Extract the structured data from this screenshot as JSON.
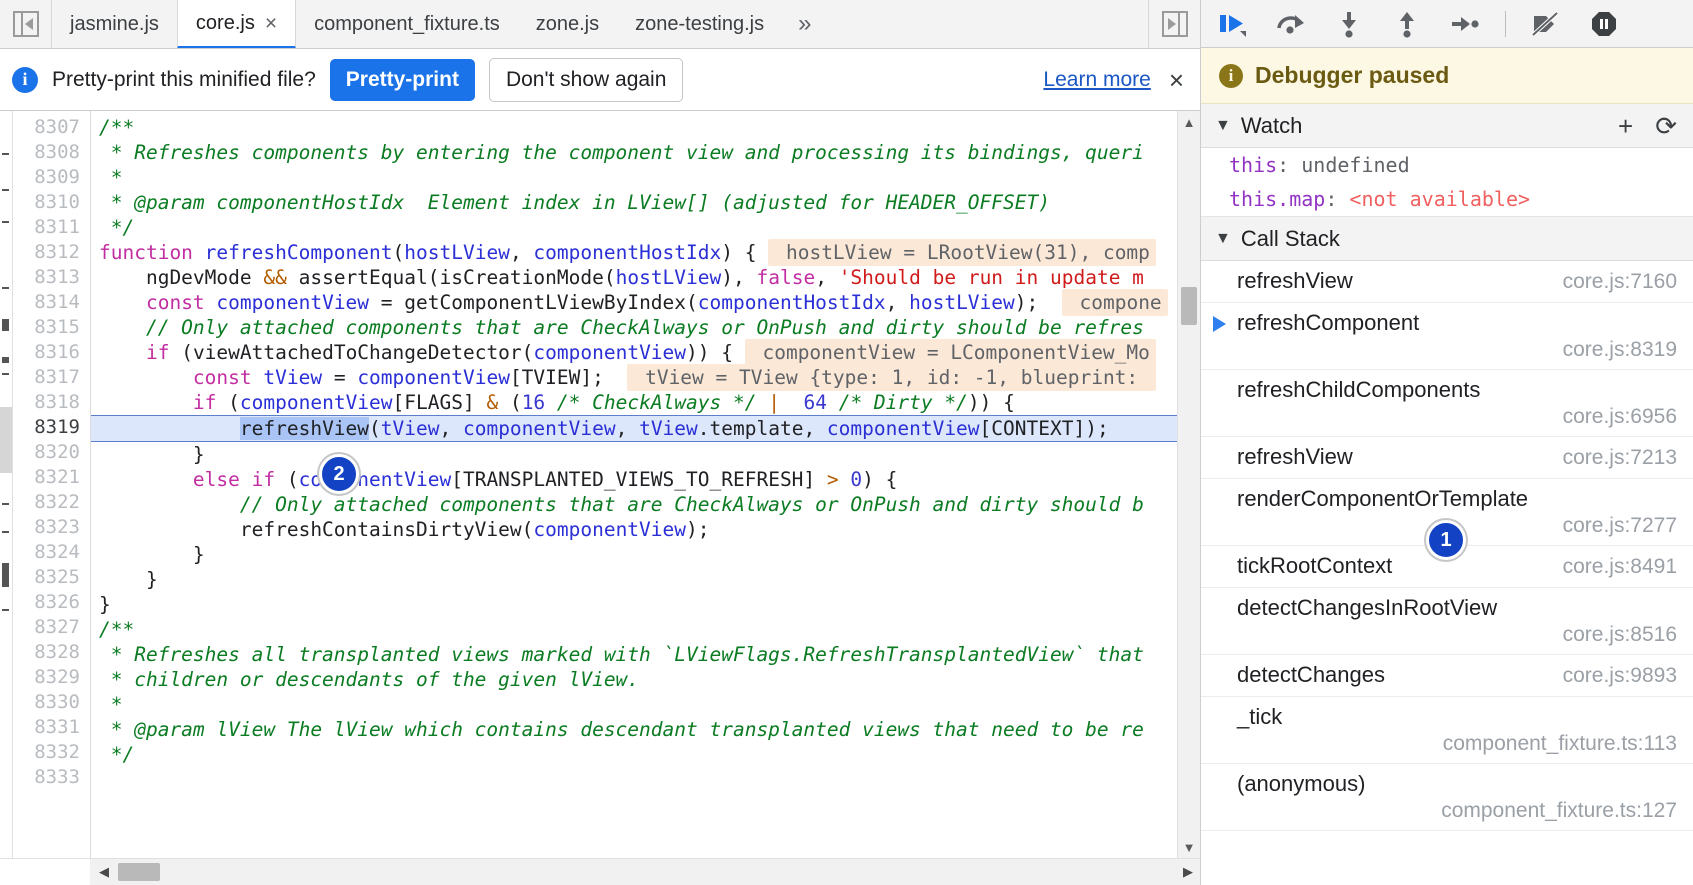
{
  "tabs": {
    "nav_prev_icon": "collapse-left-icon",
    "nav_next_icon": "expand-right-icon",
    "more_label": "»",
    "items": [
      {
        "label": "jasmine.js",
        "active": false,
        "closable": false
      },
      {
        "label": "core.js",
        "active": true,
        "closable": true,
        "close_label": "×"
      },
      {
        "label": "component_fixture.ts",
        "active": false,
        "closable": false
      },
      {
        "label": "zone.js",
        "active": false,
        "closable": false
      },
      {
        "label": "zone-testing.js",
        "active": false,
        "closable": false
      }
    ]
  },
  "infobar": {
    "icon": "info-icon",
    "message": "Pretty-print this minified file?",
    "primary_button": "Pretty-print",
    "secondary_button": "Don't show again",
    "learn_more": "Learn more",
    "close_label": "×",
    "accent_color": "#1a73e8"
  },
  "editor": {
    "first_line": 8307,
    "highlighted_line": 8319,
    "selected_token": "refreshView",
    "breakpoint_badge": "2",
    "scroll_arrow_up": "▲",
    "scroll_arrow_down": "▼",
    "hscroll_left": "◀",
    "hscroll_right": "▶",
    "line_numbers": [
      "8307",
      "8308",
      "8309",
      "8310",
      "8311",
      "8312",
      "8313",
      "8314",
      "8315",
      "8316",
      "8317",
      "8318",
      "8319",
      "8320",
      "8321",
      "8322",
      "8323",
      "8324",
      "8325",
      "8326",
      "8327",
      "8328",
      "8329",
      "8330",
      "8331",
      "8332",
      "8333"
    ],
    "lines": [
      {
        "n": "8307",
        "segs": [
          {
            "t": "/**",
            "c": "cmt"
          }
        ]
      },
      {
        "n": "8308",
        "segs": [
          {
            "t": " * Refreshes components by entering the component view and processing its bindings, queri",
            "c": "cmt"
          }
        ]
      },
      {
        "n": "8309",
        "segs": [
          {
            "t": " *",
            "c": "cmt"
          }
        ]
      },
      {
        "n": "8310",
        "segs": [
          {
            "t": " * @param componentHostIdx  Element index in LView[] (adjusted for HEADER_OFFSET)",
            "c": "cmt"
          }
        ]
      },
      {
        "n": "8311",
        "segs": [
          {
            "t": " */",
            "c": "cmt"
          }
        ]
      },
      {
        "n": "8312",
        "segs": [
          {
            "t": "function ",
            "c": "kw"
          },
          {
            "t": "refreshComponent",
            "c": "fn"
          },
          {
            "t": "(",
            "c": "id"
          },
          {
            "t": "hostLView",
            "c": "fn"
          },
          {
            "t": ", ",
            "c": "id"
          },
          {
            "t": "componentHostIdx",
            "c": "fn"
          },
          {
            "t": ") { ",
            "c": "id"
          },
          {
            "t": " hostLView = LRootView(31), comp",
            "c": "eval"
          }
        ]
      },
      {
        "n": "8313",
        "segs": [
          {
            "t": "    ngDevMode ",
            "c": "id"
          },
          {
            "t": "&&",
            "c": "op"
          },
          {
            "t": " assertEqual(isCreationMode(",
            "c": "id"
          },
          {
            "t": "hostLView",
            "c": "fn"
          },
          {
            "t": "), ",
            "c": "id"
          },
          {
            "t": "false",
            "c": "kw"
          },
          {
            "t": ", ",
            "c": "id"
          },
          {
            "t": "'Should be run in update m",
            "c": "str"
          }
        ]
      },
      {
        "n": "8314",
        "segs": [
          {
            "t": "    ",
            "c": "id"
          },
          {
            "t": "const ",
            "c": "kw"
          },
          {
            "t": "componentView",
            "c": "fn"
          },
          {
            "t": " = getComponentLViewByIndex(",
            "c": "id"
          },
          {
            "t": "componentHostIdx",
            "c": "fn"
          },
          {
            "t": ", ",
            "c": "id"
          },
          {
            "t": "hostLView",
            "c": "fn"
          },
          {
            "t": ");  ",
            "c": "id"
          },
          {
            "t": " compone",
            "c": "eval"
          }
        ]
      },
      {
        "n": "8315",
        "segs": [
          {
            "t": "    // Only attached components that are CheckAlways or OnPush and dirty should be refres",
            "c": "cmt"
          }
        ]
      },
      {
        "n": "8316",
        "segs": [
          {
            "t": "    ",
            "c": "id"
          },
          {
            "t": "if ",
            "c": "kw"
          },
          {
            "t": "(viewAttachedToChangeDetector(",
            "c": "id"
          },
          {
            "t": "componentView",
            "c": "fn"
          },
          {
            "t": ")) { ",
            "c": "id"
          },
          {
            "t": " componentView = LComponentView_Mo",
            "c": "eval"
          }
        ]
      },
      {
        "n": "8317",
        "segs": [
          {
            "t": "        ",
            "c": "id"
          },
          {
            "t": "const ",
            "c": "kw"
          },
          {
            "t": "tView",
            "c": "fn"
          },
          {
            "t": " = ",
            "c": "id"
          },
          {
            "t": "componentView",
            "c": "fn"
          },
          {
            "t": "[TVIEW];  ",
            "c": "id"
          },
          {
            "t": " tView = TView {type: 1, id: -1, blueprint: ",
            "c": "eval"
          }
        ]
      },
      {
        "n": "8318",
        "segs": [
          {
            "t": "        ",
            "c": "id"
          },
          {
            "t": "if ",
            "c": "kw"
          },
          {
            "t": "(",
            "c": "id"
          },
          {
            "t": "componentView",
            "c": "fn"
          },
          {
            "t": "[FLAGS] ",
            "c": "id"
          },
          {
            "t": "& ",
            "c": "op"
          },
          {
            "t": "(",
            "c": "id"
          },
          {
            "t": "16",
            "c": "num"
          },
          {
            "t": " /* CheckAlways */",
            "c": "cmt"
          },
          {
            "t": " | ",
            "c": "op"
          },
          {
            "t": " ",
            "c": "id"
          },
          {
            "t": "64",
            "c": "num"
          },
          {
            "t": " /* Dirty */",
            "c": "cmt"
          },
          {
            "t": ")) {",
            "c": "id"
          }
        ]
      },
      {
        "n": "8319",
        "exec": true,
        "segs": [
          {
            "t": "            ",
            "c": "id"
          },
          {
            "t": "refreshView",
            "c": "sel-token"
          },
          {
            "t": "(",
            "c": "id"
          },
          {
            "t": "tView",
            "c": "fn"
          },
          {
            "t": ", ",
            "c": "id"
          },
          {
            "t": "componentView",
            "c": "fn"
          },
          {
            "t": ", ",
            "c": "id"
          },
          {
            "t": "tView",
            "c": "fn"
          },
          {
            "t": ".template, ",
            "c": "id"
          },
          {
            "t": "componentView",
            "c": "fn"
          },
          {
            "t": "[CONTEXT]);",
            "c": "id"
          }
        ]
      },
      {
        "n": "8320",
        "segs": [
          {
            "t": "        }",
            "c": "id"
          }
        ]
      },
      {
        "n": "8321",
        "segs": [
          {
            "t": "        ",
            "c": "id"
          },
          {
            "t": "else if ",
            "c": "kw"
          },
          {
            "t": "(",
            "c": "id"
          },
          {
            "t": "componentView",
            "c": "fn"
          },
          {
            "t": "[TRANSPLANTED_VIEWS_TO_REFRESH] ",
            "c": "id"
          },
          {
            "t": "> ",
            "c": "op"
          },
          {
            "t": "0",
            "c": "num"
          },
          {
            "t": ") {",
            "c": "id"
          }
        ]
      },
      {
        "n": "8322",
        "segs": [
          {
            "t": "            // Only attached components that are CheckAlways or OnPush and dirty should b",
            "c": "cmt"
          }
        ]
      },
      {
        "n": "8323",
        "segs": [
          {
            "t": "            refreshContainsDirtyView(",
            "c": "id"
          },
          {
            "t": "componentView",
            "c": "fn"
          },
          {
            "t": ");",
            "c": "id"
          }
        ]
      },
      {
        "n": "8324",
        "segs": [
          {
            "t": "        }",
            "c": "id"
          }
        ]
      },
      {
        "n": "8325",
        "segs": [
          {
            "t": "    }",
            "c": "id"
          }
        ]
      },
      {
        "n": "8326",
        "segs": [
          {
            "t": "}",
            "c": "id"
          }
        ]
      },
      {
        "n": "8327",
        "segs": [
          {
            "t": "/**",
            "c": "cmt"
          }
        ]
      },
      {
        "n": "8328",
        "segs": [
          {
            "t": " * Refreshes all transplanted views marked with `LViewFlags.RefreshTransplantedView` that",
            "c": "cmt"
          }
        ]
      },
      {
        "n": "8329",
        "segs": [
          {
            "t": " * children or descendants of the given lView.",
            "c": "cmt"
          }
        ]
      },
      {
        "n": "8330",
        "segs": [
          {
            "t": " *",
            "c": "cmt"
          }
        ]
      },
      {
        "n": "8331",
        "segs": [
          {
            "t": " * @param lView The lView which contains descendant transplanted views that need to be re",
            "c": "cmt"
          }
        ]
      },
      {
        "n": "8332",
        "segs": [
          {
            "t": " */",
            "c": "cmt"
          }
        ]
      },
      {
        "n": "8333",
        "segs": [
          {
            "t": "",
            "c": "id"
          }
        ]
      }
    ]
  },
  "debugger": {
    "toolbar": [
      {
        "name": "resume-script-execution-button",
        "icon": "resume-icon"
      },
      {
        "name": "step-over-button",
        "icon": "step-over-icon"
      },
      {
        "name": "step-into-button",
        "icon": "step-into-icon"
      },
      {
        "name": "step-out-button",
        "icon": "step-out-icon"
      },
      {
        "name": "step-button",
        "icon": "step-icon"
      },
      {
        "name": "deactivate-breakpoints-button",
        "icon": "deactivate-breakpoints-icon"
      },
      {
        "name": "pause-on-exceptions-button",
        "icon": "pause-on-exceptions-icon"
      }
    ],
    "paused": {
      "icon": "info-circle-icon",
      "text": "Debugger paused"
    },
    "watch": {
      "caret": "▼",
      "title": "Watch",
      "add_label": "+",
      "refresh_label": "⟳",
      "entries": [
        {
          "name": "this",
          "separator": ": ",
          "value": "undefined",
          "value_kind": "undefined"
        },
        {
          "name": "this.map",
          "separator": ": ",
          "value": "<not available>",
          "value_kind": "not-available"
        }
      ]
    },
    "call_stack": {
      "caret": "▼",
      "title": "Call Stack",
      "badge": "1",
      "frames": [
        {
          "name": "refreshView",
          "location": "core.js:7160",
          "selected": false,
          "wrapped": false
        },
        {
          "name": "refreshComponent",
          "location": "core.js:8319",
          "selected": true,
          "wrapped": true
        },
        {
          "name": "refreshChildComponents",
          "location": "core.js:6956",
          "selected": false,
          "wrapped": true
        },
        {
          "name": "refreshView",
          "location": "core.js:7213",
          "selected": false,
          "wrapped": false
        },
        {
          "name": "renderComponentOrTemplate",
          "location": "core.js:7277",
          "selected": false,
          "wrapped": true
        },
        {
          "name": "tickRootContext",
          "location": "core.js:8491",
          "selected": false,
          "wrapped": false
        },
        {
          "name": "detectChangesInRootView",
          "location": "core.js:8516",
          "selected": false,
          "wrapped": true
        },
        {
          "name": "detectChanges",
          "location": "core.js:9893",
          "selected": false,
          "wrapped": false
        },
        {
          "name": "_tick",
          "location": "component_fixture.ts:113",
          "selected": false,
          "wrapped": true
        },
        {
          "name": "(anonymous)",
          "location": "component_fixture.ts:127",
          "selected": false,
          "wrapped": true
        }
      ]
    }
  }
}
